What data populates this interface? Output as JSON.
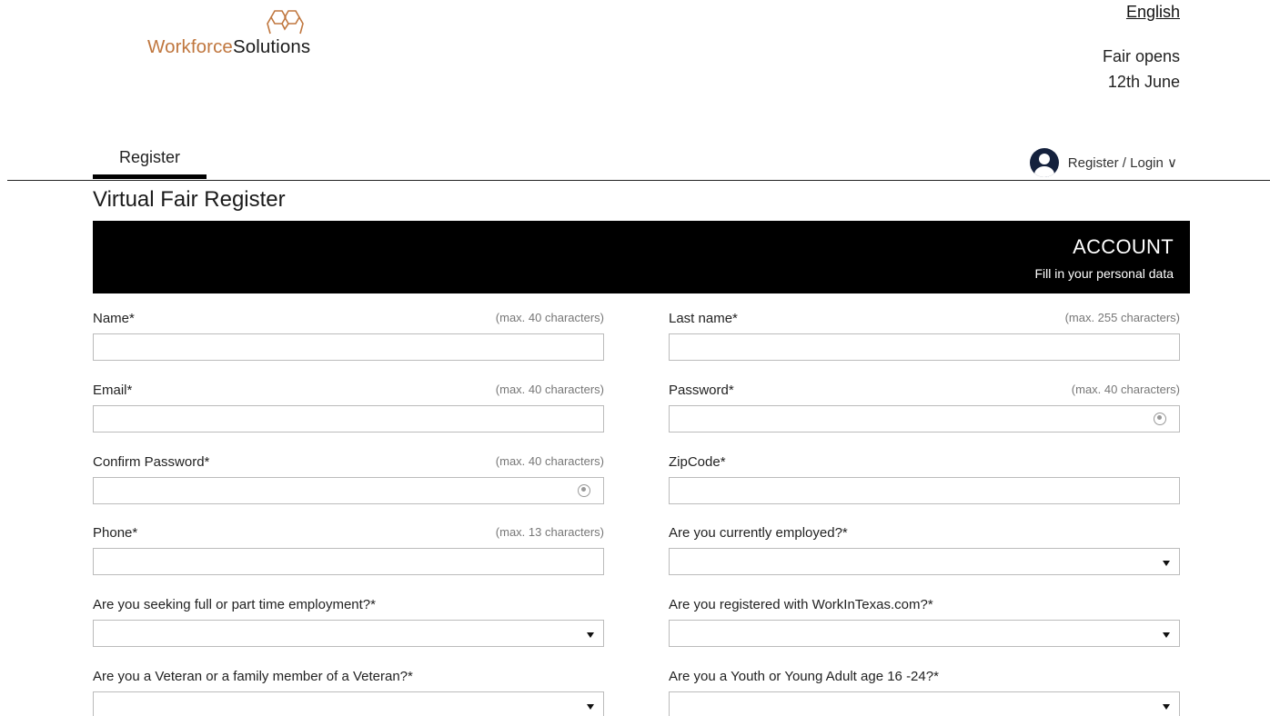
{
  "header": {
    "logo_word1": "Workforce",
    "logo_word2": "Solutions",
    "language": "English",
    "fair_line1": "Fair opens",
    "fair_line2": "12th June"
  },
  "nav": {
    "tab_label": "Register",
    "user_menu_label": "Register / Login ∨"
  },
  "page": {
    "title": "Virtual Fair Register"
  },
  "banner": {
    "title": "ACCOUNT",
    "subtitle": "Fill in your personal data"
  },
  "form": {
    "name": {
      "label": "Name*",
      "hint": "(max. 40 characters)",
      "value": ""
    },
    "last_name": {
      "label": "Last name*",
      "hint": "(max. 255 characters)",
      "value": ""
    },
    "email": {
      "label": "Email*",
      "hint": "(max. 40 characters)",
      "value": ""
    },
    "password": {
      "label": "Password*",
      "hint": "(max. 40 characters)",
      "value": ""
    },
    "confirm_password": {
      "label": "Confirm Password*",
      "hint": "(max. 40 characters)",
      "value": ""
    },
    "zipcode": {
      "label": "ZipCode*",
      "value": ""
    },
    "phone": {
      "label": "Phone*",
      "hint": "(max. 13 characters)",
      "value": ""
    },
    "employed": {
      "label": "Are you currently employed?*",
      "selected": ""
    },
    "seeking": {
      "label": "Are you seeking full or part time employment?*",
      "selected": ""
    },
    "workintexas": {
      "label": "Are you registered with WorkInTexas.com?*",
      "selected": ""
    },
    "veteran": {
      "label": "Are you a Veteran or a family member of a Veteran?*",
      "selected": ""
    },
    "youth": {
      "label": "Are you a Youth or Young Adult age 16 -24?*",
      "selected": ""
    }
  },
  "colors": {
    "brand_orange": "#c0773f",
    "banner_bg": "#000000",
    "avatar": "#14213d"
  }
}
